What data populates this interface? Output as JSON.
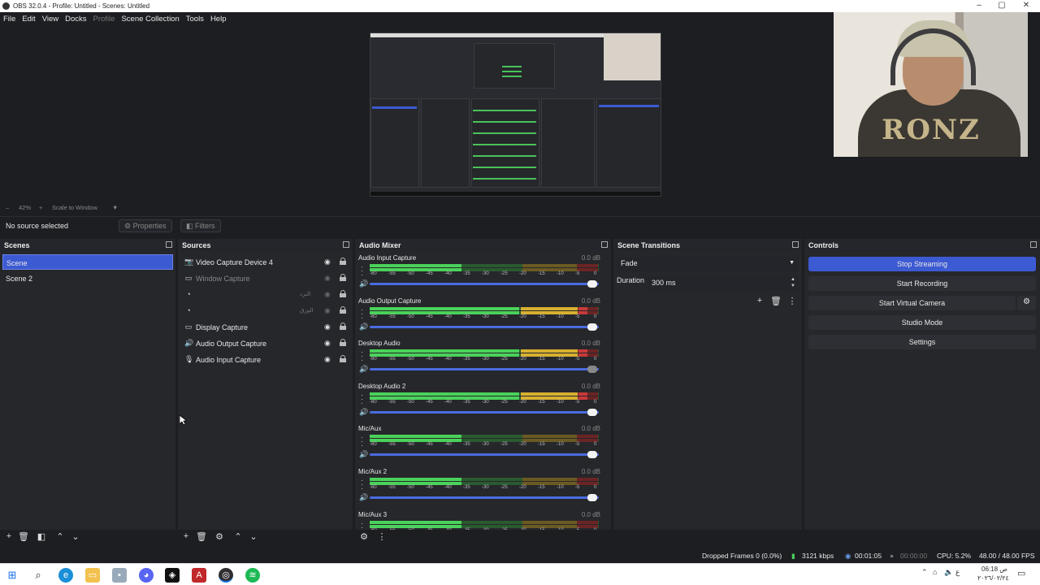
{
  "window": {
    "title": "OBS 32.0.4 - Profile: Untitled - Scenes: Untitled",
    "minimize": "–",
    "maximize": "▢",
    "close": "✕"
  },
  "menu": [
    "File",
    "Edit",
    "View",
    "Docks",
    "Profile",
    "Scene Collection",
    "Tools",
    "Help"
  ],
  "zoom": {
    "minus": "–",
    "value": "42%",
    "plus": "+",
    "mode": "Scale to Window",
    "arrow": "▼"
  },
  "toolbar": {
    "no_source": "No source selected",
    "properties": "Properties",
    "filters": "Filters"
  },
  "scenes": {
    "title": "Scenes",
    "items": [
      "Scene",
      "Scene 2"
    ]
  },
  "sources": {
    "title": "Sources",
    "items": [
      {
        "label": "Video Capture Device 4",
        "rtl": "",
        "icon": "camera-icon"
      },
      {
        "label": "Window Capture",
        "rtl": "",
        "icon": "window-icon"
      },
      {
        "label": "",
        "rtl": "النرد",
        "icon": "browser-icon"
      },
      {
        "label": "",
        "rtl": "الورق",
        "icon": "browser-icon"
      },
      {
        "label": "Display Capture",
        "rtl": "",
        "icon": "monitor-icon"
      },
      {
        "label": "Audio Output Capture",
        "rtl": "",
        "icon": "speaker-icon"
      },
      {
        "label": "Audio Input Capture",
        "rtl": "",
        "icon": "mic-icon"
      }
    ]
  },
  "mixer": {
    "title": "Audio Mixer",
    "ticks": [
      "-60",
      "-55",
      "-50",
      "-45",
      "-40",
      "-35",
      "-30",
      "-25",
      "-20",
      "-15",
      "-10",
      "-5",
      "0"
    ],
    "channels": [
      {
        "name": "Audio Input Capture",
        "db": "0.0 dB",
        "level": 0.4
      },
      {
        "name": "Audio Output Capture",
        "db": "0.0 dB",
        "level": 0.95
      },
      {
        "name": "Desktop Audio",
        "db": "0.0 dB",
        "level": 0.95
      },
      {
        "name": "Desktop Audio 2",
        "db": "0.0 dB",
        "level": 0.95
      },
      {
        "name": "Mic/Aux",
        "db": "0.0 dB",
        "level": 0.4
      },
      {
        "name": "Mic/Aux 2",
        "db": "0.0 dB",
        "level": 0.4
      },
      {
        "name": "Mic/Aux 3",
        "db": "0.0 dB",
        "level": 0.4
      }
    ]
  },
  "transitions": {
    "title": "Scene Transitions",
    "selected": "Fade",
    "duration_label": "Duration",
    "duration_value": "300 ms"
  },
  "controls": {
    "title": "Controls",
    "buttons": [
      "Stop Streaming",
      "Start Recording",
      "Start Virtual Camera",
      "Studio Mode",
      "Settings"
    ]
  },
  "status": {
    "dropped": "Dropped Frames 0 (0.0%)",
    "bitrate": "3121 kbps",
    "stream_time": "00:01:05",
    "rec_time": "00:00:00",
    "cpu": "CPU: 5.2%",
    "fps": "48.00 / 48.00 FPS"
  },
  "tray": {
    "time": "06:18 ص",
    "date": "٢٠٢٦/٠٢/٢٤",
    "lang": "ع"
  },
  "webcam_logo": "RONZ",
  "colors": {
    "accent": "#3c5ad2",
    "meter_green": "#4ad25a",
    "meter_yellow": "#d8b030",
    "meter_red": "#c83a3a"
  }
}
